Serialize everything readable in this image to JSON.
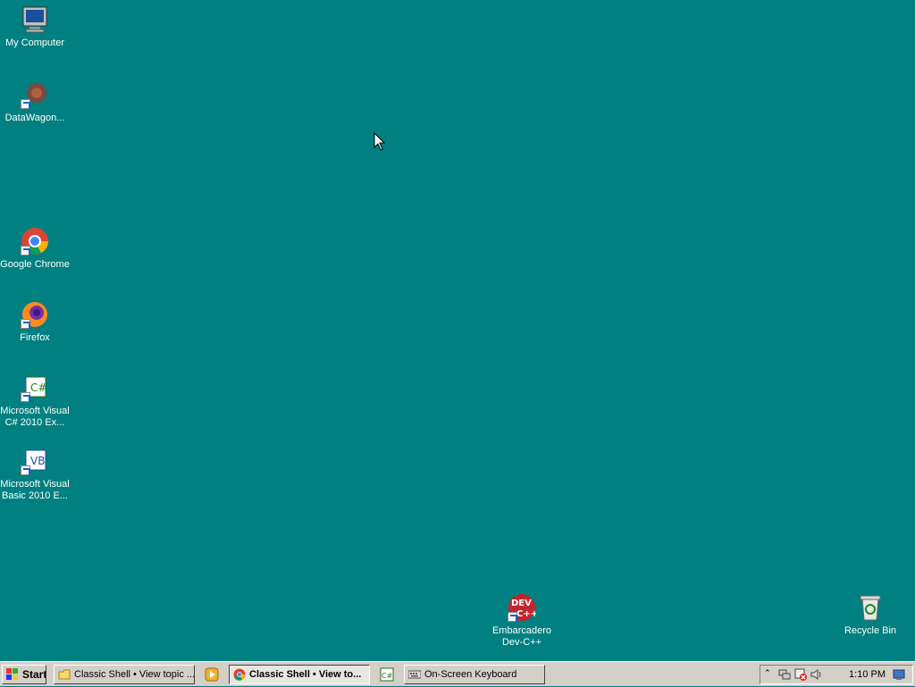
{
  "desktop": {
    "icons": [
      {
        "label": "My Computer",
        "icon": "computer-icon"
      },
      {
        "label": "DataWagon...",
        "icon": "datawagon-icon"
      },
      {
        "label": "Google Chrome",
        "icon": "chrome-icon"
      },
      {
        "label": "Firefox",
        "icon": "firefox-icon"
      },
      {
        "label_line1": "Microsoft Visual",
        "label_line2": "C# 2010 Ex...",
        "icon": "visual-csharp-icon"
      },
      {
        "label_line1": "Microsoft Visual",
        "label_line2": "Basic 2010 E...",
        "icon": "visual-basic-icon"
      },
      {
        "label_line1": "Embarcadero",
        "label_line2": "Dev-C++",
        "icon": "devcpp-icon"
      },
      {
        "label": "Recycle Bin",
        "icon": "recycle-bin-icon"
      }
    ]
  },
  "taskbar": {
    "start_label": "Start",
    "buttons": [
      {
        "label": "Classic Shell • View topic ...",
        "icon": "folder-icon"
      },
      {
        "label": "Classic Shell • View to...",
        "icon": "chrome-icon",
        "active": true
      },
      {
        "label": "On-Screen Keyboard",
        "icon": "keyboard-icon"
      }
    ],
    "tray": {
      "time": "1:10 PM"
    }
  },
  "colors": {
    "desktop": "#008080",
    "taskbar": "#d4d0c8"
  }
}
